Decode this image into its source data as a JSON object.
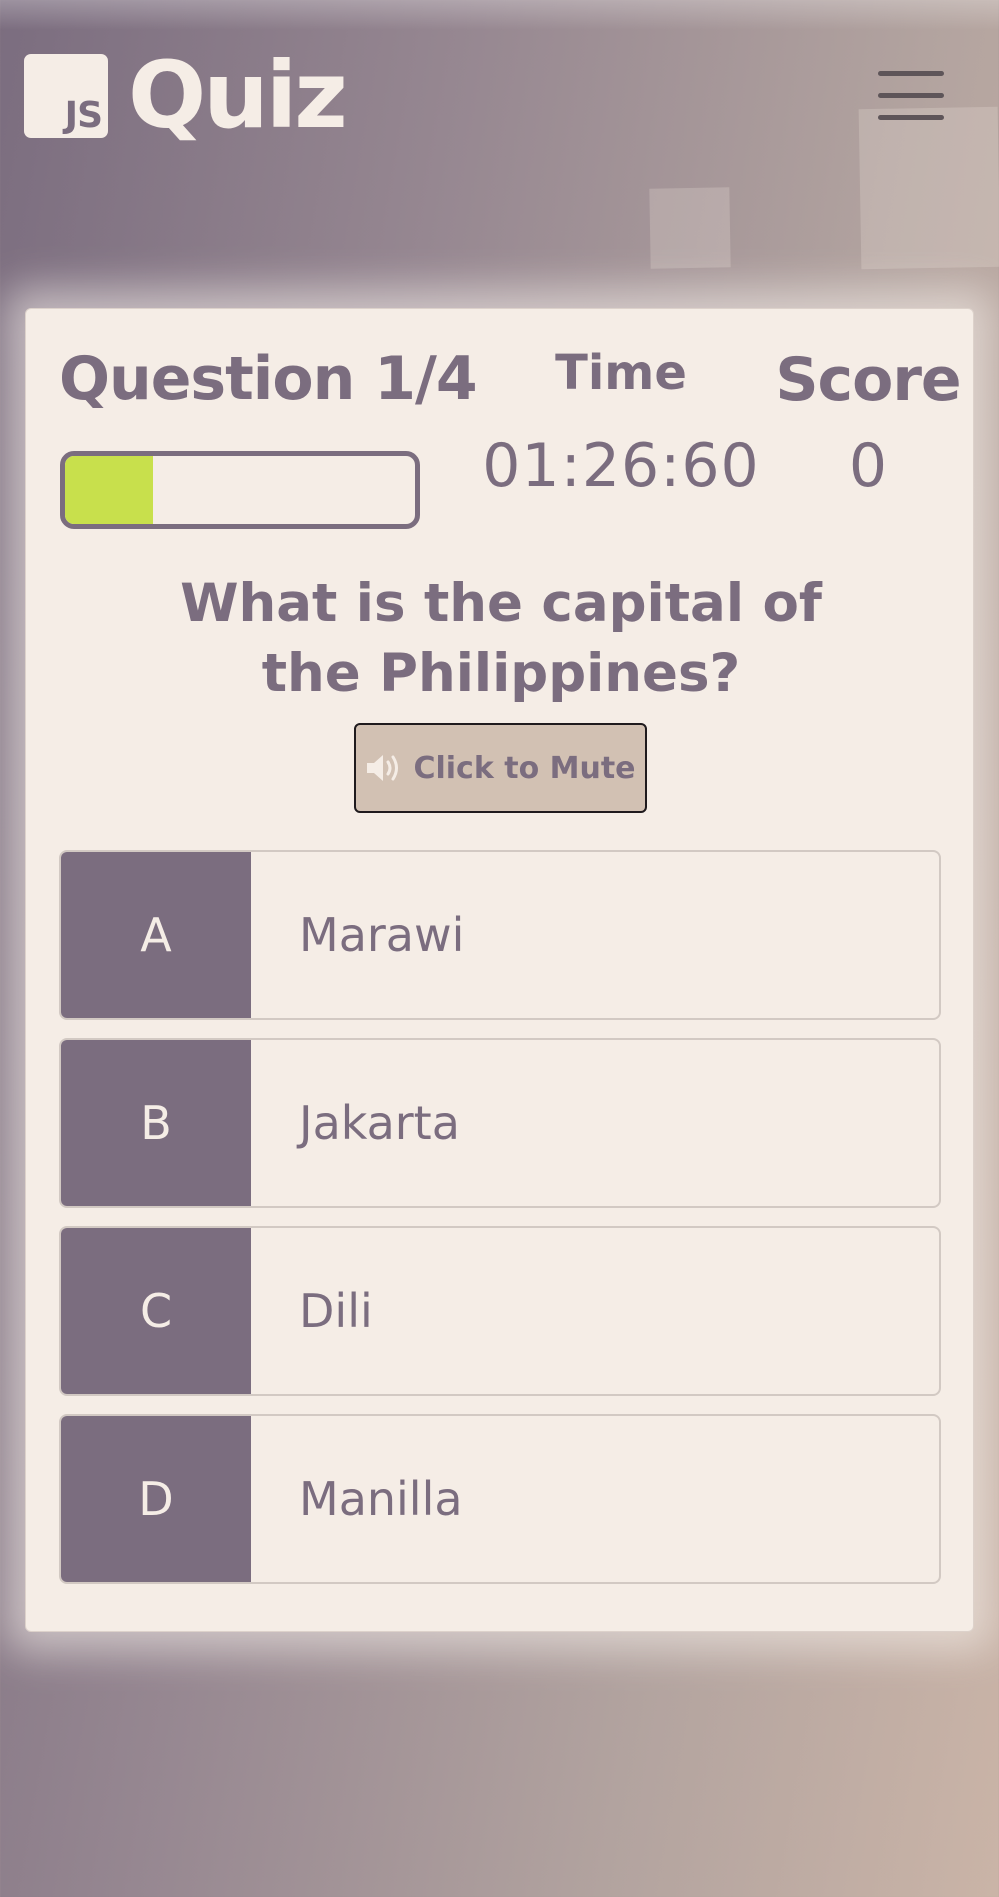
{
  "header": {
    "logo_badge": "JS",
    "title": "Quiz"
  },
  "quiz": {
    "question_counter": "Question 1/4",
    "progress_fraction": 0.25,
    "time_label": "Time",
    "time_value": "01:26:60",
    "score_label": "Score",
    "score_value": "0",
    "question_text": "What is the capital of the Philippines?",
    "mute_button_label": "Click to Mute",
    "choices": [
      {
        "prefix": "A",
        "text": "Marawi"
      },
      {
        "prefix": "B",
        "text": "Jakarta"
      },
      {
        "prefix": "C",
        "text": "Dili"
      },
      {
        "prefix": "D",
        "text": "Manilla"
      }
    ]
  },
  "colors": {
    "primary": "#7b6d7f",
    "card_background": "#f5ede6",
    "progress_fill": "#c8e04c",
    "mute_button_background": "#d2c1b3"
  },
  "icons": {
    "menu": "hamburger-menu-icon",
    "mute": "speaker-volume-icon"
  }
}
